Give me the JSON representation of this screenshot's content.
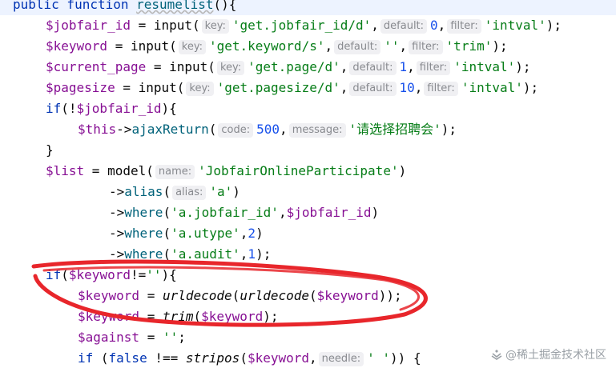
{
  "code": {
    "line1": {
      "kw": "public function",
      "fn": "resumelist",
      "rest": "(){"
    },
    "line2": {
      "var": "$jobfair_id",
      "op": " = input(",
      "hint1": "key:",
      "str1": "'get.jobfair_id/d'",
      "hint2": "default:",
      "num": "0",
      "hint3": "filter:",
      "str2": "'intval'",
      "end": ");"
    },
    "line3": {
      "var": "$keyword",
      "op": " = input(",
      "hint1": "key:",
      "str1": "'get.keyword/s'",
      "hint2": "default:",
      "str2": "''",
      "hint3": "filter:",
      "str3": "'trim'",
      "end": ");"
    },
    "line4": {
      "var": "$current_page",
      "op": " = input(",
      "hint1": "key:",
      "str1": "'get.page/d'",
      "hint2": "default:",
      "num": "1",
      "hint3": "filter:",
      "str2": "'intval'",
      "end": ");"
    },
    "line5": {
      "var": "$pagesize",
      "op": " = input(",
      "hint1": "key:",
      "str1": "'get.pagesize/d'",
      "hint2": "default:",
      "num": "10",
      "hint3": "filter:",
      "str2": "'intval'",
      "end": ");"
    },
    "line6": {
      "kw": "if",
      "p1": "(!",
      "var": "$jobfair_id",
      "p2": "){"
    },
    "line7": {
      "var": "$this",
      "arrow": "->",
      "fn": "ajaxReturn",
      "p1": "(",
      "hint1": "code:",
      "num": "500",
      "hint2": "message:",
      "str": "'请选择招聘会'",
      "end": ");"
    },
    "line8": {
      "text": "}"
    },
    "line9": {
      "var": "$list",
      "op": " = model(",
      "hint1": "name:",
      "str": "'JobfairOnlineParticipate'",
      "end": ")"
    },
    "line10": {
      "arrow": "->",
      "fn": "alias",
      "p1": "(",
      "hint1": "alias:",
      "str": "'a'",
      "end": ")"
    },
    "line11": {
      "arrow": "->",
      "fn": "where",
      "p1": "(",
      "str": "'a.jobfair_id'",
      "comma": ",",
      "var": "$jobfair_id",
      "end": ")"
    },
    "line12": {
      "arrow": "->",
      "fn": "where",
      "p1": "(",
      "str": "'a.utype'",
      "comma": ",",
      "num": "2",
      "end": ")"
    },
    "line13": {
      "arrow": "->",
      "fn": "where",
      "p1": "(",
      "str": "'a.audit'",
      "comma": ",",
      "num": "1",
      "end": ");"
    },
    "line14": {
      "kw": "if",
      "p1": "(",
      "var": "$keyword",
      "op": "!=",
      "str": "''",
      "end": "){"
    },
    "line15": {
      "var": "$keyword",
      "op": " = ",
      "fn1": "urldecode",
      "p1": "(",
      "fn2": "urldecode",
      "p2": "(",
      "var2": "$keyword",
      "end": "));"
    },
    "line16": {
      "var": "$keyword",
      "op": " = ",
      "fn": "trim",
      "p1": "(",
      "var2": "$keyword",
      "end": ");"
    },
    "line17": {
      "var": "$against",
      "op": " = ",
      "str": "''",
      "end": ";"
    },
    "line18": {
      "kw": "if",
      "p1": " (",
      "kw2": "false",
      "op": " !== ",
      "fn": "stripos",
      "p2": "(",
      "var": "$keyword",
      "comma": ",",
      "hint1": "needle:",
      "str": "' '",
      "end": ")) {"
    }
  },
  "watermark": {
    "text": "@稀土掘金技术社区"
  },
  "colors": {
    "annotation": "#e8262b",
    "keyword": "#0033b3",
    "variable": "#871094",
    "function": "#00627a",
    "string": "#067d17",
    "number": "#1750eb"
  }
}
